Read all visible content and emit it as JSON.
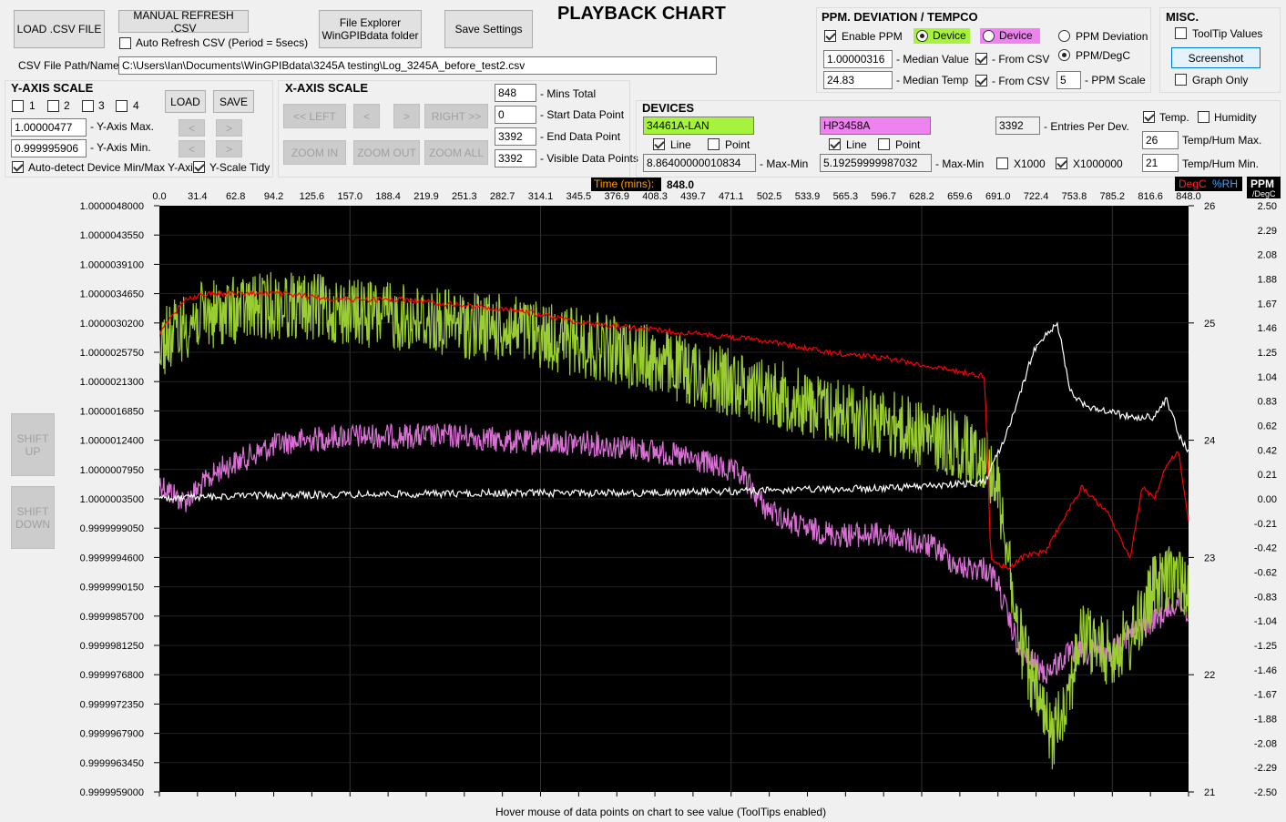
{
  "title": "PLAYBACK CHART",
  "file": {
    "load_csv": "LOAD .CSV FILE",
    "manual_refresh": "MANUAL REFRESH .CSV",
    "auto_refresh": "Auto Refresh CSV (Period = 5secs)",
    "explorer_line1": "File Explorer",
    "explorer_line2": "WinGPIBdata folder",
    "save_settings": "Save Settings",
    "path_label": "CSV File Path/Name -",
    "path_value": "C:\\Users\\Ian\\Documents\\WinGPIBdata\\3245A testing\\Log_3245A_before_test2.csv"
  },
  "yaxis": {
    "title": "Y-AXIS SCALE",
    "slots": [
      "1",
      "2",
      "3",
      "4"
    ],
    "load": "LOAD",
    "save": "SAVE",
    "max_value": "1.00000477",
    "max_label": "- Y-Axis Max.",
    "min_value": "0.999995906",
    "min_label": "- Y-Axis Min.",
    "up_arrow": "<",
    "down_arrow": ">",
    "auto_detect": "Auto-detect Device Min/Max Y-Axis",
    "tidy": "Y-Scale Tidy"
  },
  "xaxis": {
    "title": "X-AXIS SCALE",
    "left": "<< LEFT",
    "lt": "<",
    "gt": ">",
    "right": "RIGHT >>",
    "zoom_in": "ZOOM IN",
    "zoom_out": "ZOOM OUT",
    "zoom_all": "ZOOM ALL",
    "mins_total": "848",
    "mins_total_label": "- Mins Total",
    "start_point": "0",
    "start_point_label": "- Start Data Point",
    "end_point": "3392",
    "end_point_label": "- End Data Point",
    "visible_points": "3392",
    "visible_points_label": "- Visible Data Points"
  },
  "ppm": {
    "title": "PPM. DEVIATION / TEMPCO",
    "enable": "Enable PPM",
    "device1": "Device",
    "device2": "Device",
    "deviation": "PPM Deviation",
    "per_degc": "PPM/DegC",
    "median_value": "1.00000316",
    "median_value_label": "- Median Value",
    "median_temp": "24.83",
    "median_temp_label": "- Median Temp",
    "from_csv1": "- From CSV",
    "from_csv2": "- From CSV",
    "scale": "5",
    "scale_label": "- PPM Scale"
  },
  "misc": {
    "title": "MISC.",
    "tooltip": "ToolTip Values",
    "screenshot": "Screenshot",
    "graph_only": "Graph Only"
  },
  "devices": {
    "title": "DEVICES",
    "dev1": "34461A-LAN",
    "dev1_color": "#a6f23c",
    "dev2": "HP3458A",
    "dev2_color": "#ee82ee",
    "line": "Line",
    "point": "Point",
    "dev1_maxmin": "8.86400000010834",
    "dev2_maxmin": "5.19259999987032",
    "maxmin_label": "- Max-Min",
    "x1000": "X1000",
    "x1000000": "X1000000",
    "entries": "3392",
    "entries_label": "- Entries Per Dev.",
    "temp": "Temp.",
    "humidity": "Humidity",
    "temp_max": "26",
    "temp_max_label": "Temp/Hum Max.",
    "temp_min": "21",
    "temp_min_label": "Temp/Hum Min."
  },
  "shift_up": [
    "SHIFT",
    "UP"
  ],
  "shift_down": [
    "SHIFT",
    "DOWN"
  ],
  "hover_hint": "Hover mouse of data points on chart to see value (ToolTips enabled)",
  "chart_data": {
    "type": "line",
    "time_label": "Time (mins):",
    "time_value": "848.0",
    "right_labels": [
      "DegC",
      "%RH",
      "PPM",
      "/DegC"
    ],
    "colors": {
      "dev1": "#9acd32",
      "dev2": "#da70d6",
      "temp": "#ff0000",
      "ppm": "#ffffff",
      "bg": "#000000"
    },
    "x_ticks": [
      "0.0",
      "31.4",
      "62.8",
      "94.2",
      "125.6",
      "157.0",
      "188.4",
      "219.9",
      "251.3",
      "282.7",
      "314.1",
      "345.5",
      "376.9",
      "408.3",
      "439.7",
      "471.1",
      "502.5",
      "533.9",
      "565.3",
      "596.7",
      "628.2",
      "659.6",
      "691.0",
      "722.4",
      "753.8",
      "785.2",
      "816.6",
      "848.0"
    ],
    "y_ticks": [
      "1.0000048000",
      "1.0000043550",
      "1.0000039100",
      "1.0000034650",
      "1.0000030200",
      "1.0000025750",
      "1.0000021300",
      "1.0000016850",
      "1.0000012400",
      "1.0000007950",
      "1.0000003500",
      "0.9999999050",
      "0.9999994600",
      "0.9999990150",
      "0.9999985700",
      "0.9999981250",
      "0.9999976800",
      "0.9999972350",
      "0.9999967900",
      "0.9999963450",
      "0.9999959000"
    ],
    "temp_ticks": [
      "26",
      "25",
      "24",
      "23",
      "22",
      "21"
    ],
    "ppm_ticks": [
      "2.50",
      "2.29",
      "2.08",
      "1.88",
      "1.67",
      "1.46",
      "1.25",
      "1.04",
      "0.83",
      "0.62",
      "0.42",
      "0.21",
      "0.00",
      "-0.21",
      "-0.42",
      "-0.62",
      "-0.83",
      "-1.04",
      "-1.25",
      "-1.46",
      "-1.67",
      "-1.88",
      "-2.08",
      "-2.29",
      "-2.50"
    ],
    "xlim": [
      0,
      848
    ],
    "ylim": [
      0.9999959,
      1.0000048
    ],
    "temp_lim": [
      21,
      26
    ],
    "ppm_lim": [
      -2.5,
      2.5
    ],
    "series": [
      {
        "name": "34461A-LAN",
        "x": [
          0,
          30,
          60,
          100,
          150,
          200,
          250,
          300,
          350,
          400,
          450,
          500,
          550,
          600,
          650,
          680,
          690,
          700,
          705,
          720,
          735,
          750,
          760,
          780,
          800,
          820,
          840,
          848
        ],
        "y": [
          1.0000027,
          1.0000031,
          1.0000032,
          1.0000033,
          1.0000032,
          1.0000031,
          1.000003,
          1.0000029,
          1.0000027,
          1.0000025,
          1.0000022,
          1.000002,
          1.0000017,
          1.0000015,
          1.0000012,
          1.000001,
          1.0000006,
          0.9999995,
          0.9999985,
          0.9999975,
          0.9999967,
          0.9999975,
          0.9999983,
          0.999998,
          0.9999982,
          0.999999,
          0.9999992,
          0.999999
        ]
      },
      {
        "name": "HP3458A",
        "x": [
          0,
          20,
          50,
          100,
          150,
          200,
          250,
          300,
          350,
          400,
          450,
          480,
          500,
          530,
          560,
          600,
          640,
          660,
          680,
          690,
          700,
          710,
          730,
          750,
          780,
          800,
          820,
          840,
          848
        ],
        "y": [
          1.0000006,
          1.0000003,
          1.0000008,
          1.0000012,
          1.0000013,
          1.0000013,
          1.0000013,
          1.0000012,
          1.0000012,
          1.0000011,
          1.0000009,
          1.0000007,
          1.0000002,
          0.9999999,
          0.9999998,
          0.9999998,
          0.9999996,
          0.9999993,
          0.9999993,
          0.9999991,
          0.9999985,
          0.999998,
          0.9999977,
          0.999998,
          0.999998,
          0.9999983,
          0.9999985,
          0.9999988,
          0.9999986
        ]
      },
      {
        "name": "DegC",
        "x": [
          0,
          20,
          40,
          60,
          100,
          150,
          200,
          250,
          300,
          350,
          400,
          450,
          500,
          550,
          600,
          650,
          680,
          685,
          690,
          700,
          710,
          730,
          760,
          780,
          800,
          810,
          820,
          830,
          840,
          848
        ],
        "y": [
          24.9,
          25.2,
          25.25,
          25.25,
          25.25,
          25.2,
          25.2,
          25.15,
          25.1,
          25.0,
          24.95,
          24.9,
          24.85,
          24.75,
          24.7,
          24.6,
          24.55,
          23.0,
          22.95,
          22.9,
          23.0,
          23.05,
          23.6,
          23.4,
          23.0,
          23.6,
          23.5,
          23.8,
          23.9,
          23.3
        ]
      },
      {
        "name": "PPM/DegC",
        "x": [
          0,
          50,
          100,
          200,
          300,
          400,
          500,
          600,
          650,
          680,
          700,
          720,
          730,
          740,
          750,
          760,
          780,
          800,
          820,
          830,
          840,
          848
        ],
        "y": [
          0.0,
          0.02,
          0.03,
          0.04,
          0.05,
          0.05,
          0.07,
          0.09,
          0.12,
          0.14,
          0.6,
          1.25,
          1.4,
          1.5,
          0.95,
          0.8,
          0.75,
          0.7,
          0.7,
          0.85,
          0.55,
          0.4
        ]
      }
    ]
  }
}
